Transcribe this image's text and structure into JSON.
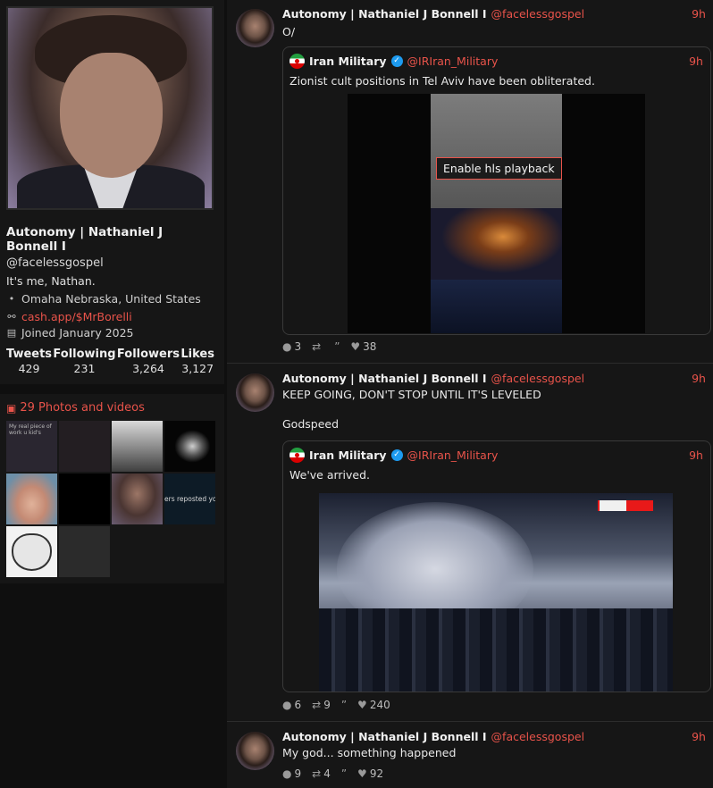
{
  "profile": {
    "fullname": "Autonomy | Nathaniel J Bonnell I",
    "handle": "@facelessgospel",
    "bio": "It's me, Nathan.",
    "location": "Omaha Nebraska, United States",
    "website": "cash.app/$MrBorelli",
    "joined": "Joined January 2025",
    "stats": [
      {
        "label": "Tweets",
        "value": "429"
      },
      {
        "label": "Following",
        "value": "231"
      },
      {
        "label": "Followers",
        "value": "3,264"
      },
      {
        "label": "Likes",
        "value": "3,127"
      }
    ]
  },
  "media": {
    "title": "29 Photos and videos",
    "thumb_texts": {
      "t1": "My real piece of work u kid's",
      "t8": "ers reposted your p"
    }
  },
  "colors": {
    "accent": "#e8534a",
    "verified": "#1d9bf0",
    "background": "#0f0f0f",
    "card": "#161616"
  },
  "icons": {
    "location": "location-pin-icon",
    "link": "link-icon",
    "calendar": "calendar-icon",
    "media": "image-icon",
    "reply": "comment-icon",
    "retweet": "retweet-icon",
    "quote": "quote-icon",
    "like": "heart-icon"
  },
  "tweets": [
    {
      "name": "Autonomy | Nathaniel J Bonnell I",
      "handle": "@facelessgospel",
      "time": "9h",
      "text": "O/",
      "quote": {
        "name": "Iran Military",
        "handle": "@IRIran_Military",
        "time": "9h",
        "text": "Zionist cult positions in Tel Aviv have been obliterated.",
        "video_button": "Enable hls playback"
      },
      "stats": {
        "replies": "3",
        "retweets": "",
        "quotes": "",
        "likes": "38"
      }
    },
    {
      "name": "Autonomy | Nathaniel J Bonnell I",
      "handle": "@facelessgospel",
      "time": "9h",
      "text_line1": "KEEP GOING, DON'T STOP UNTIL IT'S LEVELED",
      "text_line2": "Godspeed",
      "quote": {
        "name": "Iran Military",
        "handle": "@IRIran_Military",
        "time": "9h",
        "text": "We've arrived."
      },
      "stats": {
        "replies": "6",
        "retweets": "9",
        "quotes": "",
        "likes": "240"
      }
    },
    {
      "name": "Autonomy | Nathaniel J Bonnell I",
      "handle": "@facelessgospel",
      "time": "9h",
      "text": "My god... something happened",
      "stats": {
        "replies": "9",
        "retweets": "4",
        "quotes": "",
        "likes": "92"
      }
    }
  ]
}
